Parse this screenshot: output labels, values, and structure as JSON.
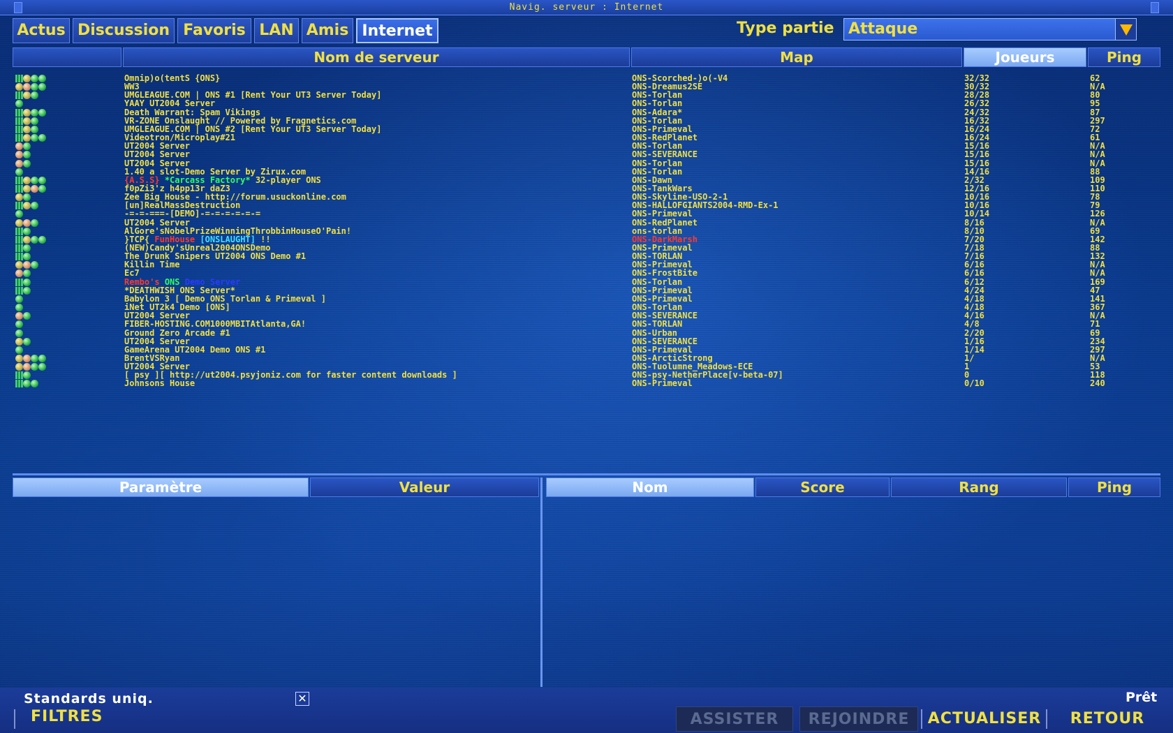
{
  "window": {
    "title": "Navig. serveur : Internet"
  },
  "tabs": [
    {
      "label": "Actus",
      "active": false
    },
    {
      "label": "Discussion",
      "active": false
    },
    {
      "label": "Favoris",
      "active": false
    },
    {
      "label": "LAN",
      "active": false
    },
    {
      "label": "Amis",
      "active": false
    },
    {
      "label": "Internet",
      "active": true
    }
  ],
  "game_type": {
    "label": "Type partie",
    "value": "Attaque"
  },
  "server_table": {
    "columns": [
      "",
      "Nom de serveur",
      "Map",
      "Joueurs",
      "Ping"
    ],
    "sorted_column": "Joueurs",
    "rows": [
      {
        "icons": [
          "bar",
          "t",
          "g",
          "g"
        ],
        "name": "Omnip)o(tentS {ONS}",
        "map": "ONS-Scorched-)o(-V4",
        "players": "32/32",
        "ping": "62"
      },
      {
        "icons": [
          "t",
          "p",
          "g",
          "g"
        ],
        "name": "WW3",
        "map": "ONS-Dreamus2SE",
        "players": "30/32",
        "ping": "N/A"
      },
      {
        "icons": [
          "bar",
          "t",
          "g"
        ],
        "name": "UMGLEAGUE.COM | ONS #1 [Rent Your UT3 Server Today]",
        "map": "ONS-Torlan",
        "players": "28/28",
        "ping": "80"
      },
      {
        "icons": [
          "g"
        ],
        "name": "YAAY UT2004 Server",
        "map": "ONS-Torlan",
        "players": "26/32",
        "ping": "95"
      },
      {
        "icons": [
          "bar",
          "t",
          "g",
          "g"
        ],
        "name": "Death Warrant: Spam Vikings",
        "map": "ONS-Adara*",
        "players": "24/32",
        "ping": "87"
      },
      {
        "icons": [
          "bar",
          "t",
          "g"
        ],
        "name": "VR-ZONE Onslaught // Powered by Fragnetics.com",
        "map": "ONS-Torlan",
        "players": "16/32",
        "ping": "297"
      },
      {
        "icons": [
          "bar",
          "t",
          "g"
        ],
        "name": "UMGLEAGUE.COM | ONS #2 [Rent Your UT3 Server Today]",
        "map": "ONS-Primeval",
        "players": "16/24",
        "ping": "72"
      },
      {
        "icons": [
          "bar",
          "t",
          "g",
          "g"
        ],
        "name": "Videotron/Microplay#21",
        "map": "ONS-RedPlanet",
        "players": "16/24",
        "ping": "61"
      },
      {
        "icons": [
          "p",
          "g"
        ],
        "name": "UT2004 Server",
        "map": "ONS-Torlan",
        "players": "15/16",
        "ping": "N/A"
      },
      {
        "icons": [
          "p",
          "g"
        ],
        "name": "UT2004 Server",
        "map": "ONS-SEVERANCE",
        "players": "15/16",
        "ping": "N/A"
      },
      {
        "icons": [
          "p",
          "g"
        ],
        "name": "UT2004 Server",
        "map": "ONS-Torlan",
        "players": "15/16",
        "ping": "N/A"
      },
      {
        "icons": [
          "g"
        ],
        "name": "1.40 a slot-Demo Server by Zirux.com",
        "map": "ONS-Torlan",
        "players": "14/16",
        "ping": "88"
      },
      {
        "icons": [
          "bar",
          "t",
          "g",
          "g"
        ],
        "name": "{A.S.S} *Carcass Factory* 32-player ONS",
        "map": "ONS-Dawn",
        "players": "2/32",
        "ping": "109"
      },
      {
        "icons": [
          "bar",
          "t",
          "p",
          "g"
        ],
        "name": "f0pZi3'z h4pp13r daZ3",
        "map": "ONS-TankWars",
        "players": "12/16",
        "ping": "110"
      },
      {
        "icons": [
          "t",
          "g"
        ],
        "name": "Zee Big House - http://forum.usuckonline.com",
        "map": "ONS-Skyline-USO-2-1",
        "players": "10/16",
        "ping": "78"
      },
      {
        "icons": [
          "bar",
          "t",
          "g"
        ],
        "name": "[un]RealMassDestruction",
        "map": "ONS-HALLOFGIANTS2004-RMD-Ex-1",
        "players": "10/16",
        "ping": "79"
      },
      {
        "icons": [
          "g"
        ],
        "name": "-=-=-===-[DEMO]-=-=-=-=-=-=",
        "map": "ONS-Primeval",
        "players": "10/14",
        "ping": "126"
      },
      {
        "icons": [
          "t",
          "p",
          "g"
        ],
        "name": "UT2004 Server",
        "map": "ONS-RedPlanet",
        "players": "8/16",
        "ping": "N/A"
      },
      {
        "icons": [
          "bar",
          "g"
        ],
        "name": "AlGore'sNobelPrizeWinningThrobbinHouseO'Pain!",
        "map": "ons-torlan",
        "players": "8/10",
        "ping": "69"
      },
      {
        "icons": [
          "bar",
          "t",
          "g",
          "g"
        ],
        "name": "}TCP{ FunHouse [ONSLAUGHT] !!",
        "map": "ONS-DarkMarsh",
        "players": "7/20",
        "ping": "142"
      },
      {
        "icons": [
          "bar",
          "g"
        ],
        "name": "(NEW)Candy'sUnreal2004ONSDemo",
        "map": "ONS-Primeval",
        "players": "7/18",
        "ping": "88"
      },
      {
        "icons": [
          "bar",
          "g"
        ],
        "name": "The Drunk Snipers UT2004 ONS Demo #1",
        "map": "ONS-TORLAN",
        "players": "7/16",
        "ping": "132"
      },
      {
        "icons": [
          "t",
          "p",
          "g"
        ],
        "name": "Killin Time",
        "map": "ONS-Primeval",
        "players": "6/16",
        "ping": "N/A"
      },
      {
        "icons": [
          "p",
          "g"
        ],
        "name": "Ec7",
        "map": "ONS-FrostBite",
        "players": "6/16",
        "ping": "N/A"
      },
      {
        "icons": [
          "bar",
          "g"
        ],
        "name": "Rembo's ONS Demo Server",
        "map": "ONS-Torlan",
        "players": "6/12",
        "ping": "169"
      },
      {
        "icons": [
          "bar",
          "g"
        ],
        "name": "*DEATHWISH ONS Server*",
        "map": "ONS-Primeval",
        "players": "4/24",
        "ping": "47"
      },
      {
        "icons": [
          "g"
        ],
        "name": "Babylon 3 [ Demo ONS Torlan & Primeval ]",
        "map": "ONS-Primeval",
        "players": "4/18",
        "ping": "141"
      },
      {
        "icons": [
          "g"
        ],
        "name": "iNet UT2k4 Demo [ONS]",
        "map": "ONS-Torlan",
        "players": "4/18",
        "ping": "367"
      },
      {
        "icons": [
          "p",
          "g"
        ],
        "name": "UT2004 Server",
        "map": "ONS-SEVERANCE",
        "players": "4/16",
        "ping": "N/A"
      },
      {
        "icons": [
          "g"
        ],
        "name": "FIBER-HOSTING.COM1000MBITAtlanta,GA!",
        "map": "ONS-TORLAN",
        "players": "4/8",
        "ping": "71"
      },
      {
        "icons": [
          "g"
        ],
        "name": "Ground Zero Arcade #1",
        "map": "ONS-Urban",
        "players": "2/20",
        "ping": "69"
      },
      {
        "icons": [
          "t",
          "g"
        ],
        "name": "UT2004 Server",
        "map": "ONS-SEVERANCE",
        "players": "1/16",
        "ping": "234"
      },
      {
        "icons": [
          "g"
        ],
        "name": "GameArena UT2004 Demo ONS #1",
        "map": "ONS-Primeval",
        "players": "1/14",
        "ping": "297"
      },
      {
        "icons": [
          "t",
          "p",
          "g",
          "g"
        ],
        "name": "BrentVSRyan",
        "map": "ONS-ArcticStrong",
        "players": "1/",
        "ping": "N/A"
      },
      {
        "icons": [
          "t",
          "p",
          "g",
          "g"
        ],
        "name": "UT2004 Server",
        "map": "ONS-Tuolumne_Meadows-ECE",
        "players": "1",
        "ping": "53"
      },
      {
        "icons": [
          "bar",
          "g"
        ],
        "name": "[ psy ][ http://ut2004.psyjoniz.com for faster content downloads ]",
        "map": "ONS-psy-NetherPlace[v-beta-07]",
        "players": "0",
        "ping": "118"
      },
      {
        "icons": [
          "bar",
          "g",
          "g"
        ],
        "name": "Johnsons House",
        "map": "ONS-Primeval",
        "players": "0/10",
        "ping": "240"
      }
    ]
  },
  "rule_table": {
    "columns": [
      "Paramètre",
      "Valeur"
    ]
  },
  "player_table": {
    "columns": [
      "Nom",
      "Score",
      "Rang",
      "Ping"
    ]
  },
  "footer": {
    "standards_label": "Standards uniq.",
    "standards_checked": true,
    "check_mark": "✕",
    "filters": "FILTRES",
    "status": "Prêt",
    "buttons": [
      {
        "label": "ASSISTER",
        "enabled": false
      },
      {
        "label": "REJOINDRE",
        "enabled": false
      },
      {
        "label": "ACTUALISER",
        "enabled": true
      },
      {
        "label": "RETOUR",
        "enabled": true
      }
    ]
  },
  "colors": {
    "accent_yellow": "#f0e040",
    "panel_blue": "#1b3c98",
    "selected_header": "#a8ccff"
  }
}
